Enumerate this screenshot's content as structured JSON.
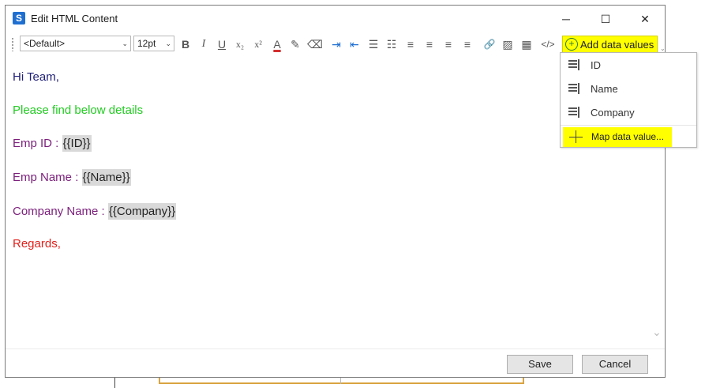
{
  "window": {
    "title": "Edit HTML Content",
    "app_icon": "S",
    "controls": {
      "minimize": "─",
      "maximize": "☐",
      "close": "✕"
    }
  },
  "toolbar": {
    "font_family": "<Default>",
    "font_size": "12pt",
    "dropdown_arrow": "⌄",
    "bold": "B",
    "italic": "I",
    "underline": "U",
    "subscript": "x₂",
    "superscript": "x²",
    "font_color": "A",
    "highlight": "✎",
    "eraser": "⌫",
    "indent": "⇥",
    "outdent": "⇤",
    "bullet_list": "☰",
    "numbered_list": "☷",
    "align_left": "≡",
    "align_center": "≡",
    "align_right": "≡",
    "justify": "≡",
    "link": "🔗",
    "image": "▨",
    "table": "▦",
    "source": "</>",
    "add_data_values": "Add data values",
    "add_icon": "+"
  },
  "editor": {
    "greeting": "Hi Team,",
    "intro": "Please find below details",
    "emp_id_label": "Emp ID : ",
    "emp_id_token": "{{ID}}",
    "emp_name_label": "Emp Name : ",
    "emp_name_token": "{{Name}}",
    "company_label": "Company Name : ",
    "company_token": "{{Company}}",
    "closing": "Regards,"
  },
  "colors": {
    "greeting": "#1f1f7a",
    "intro": "#22cc22",
    "fields": "#7b1f7b",
    "closing": "#e0201a",
    "highlight": "#ffff00"
  },
  "dropdown": {
    "items": [
      "ID",
      "Name",
      "Company"
    ],
    "map_label": "Map data value..."
  },
  "footer": {
    "save": "Save",
    "cancel": "Cancel"
  }
}
